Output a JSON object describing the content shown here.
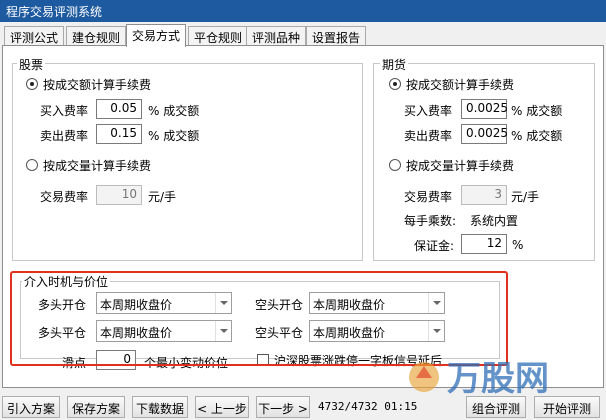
{
  "window": {
    "title": "程序交易评测系统"
  },
  "tabs": [
    "评测公式",
    "建仓规则",
    "交易方式",
    "平仓规则",
    "评测品种",
    "设置报告"
  ],
  "stocks": {
    "legend": "股票",
    "by_amount_label": "按成交额计算手续费",
    "buy_label": "买入费率",
    "buy_value": "0.05",
    "buy_unit": "% 成交额",
    "sell_label": "卖出费率",
    "sell_value": "0.15",
    "sell_unit": "% 成交额",
    "by_volume_label": "按成交量计算手续费",
    "rate_label": "交易费率",
    "rate_value": "10",
    "rate_unit": "元/手"
  },
  "futures": {
    "legend": "期货",
    "by_amount_label": "按成交额计算手续费",
    "buy_label": "买入费率",
    "buy_value": "0.0025",
    "buy_unit": "% 成交额",
    "sell_label": "卖出费率",
    "sell_value": "0.0025",
    "sell_unit": "% 成交额",
    "by_volume_label": "按成交量计算手续费",
    "rate_label": "交易费率",
    "rate_value": "3",
    "rate_unit": "元/手",
    "multiplier_label": "每手乘数:",
    "multiplier_value": "系统内置",
    "margin_label": "保证金:",
    "margin_value": "12",
    "margin_unit": "%"
  },
  "entry": {
    "legend": "介入时机与价位",
    "long_open_label": "多头开仓",
    "long_open_value": "本周期收盘价",
    "short_open_label": "空头开仓",
    "short_open_value": "本周期收盘价",
    "long_close_label": "多头平仓",
    "long_close_value": "本周期收盘价",
    "short_close_label": "空头平仓",
    "short_close_value": "本周期收盘价",
    "slippage_label": "滑点",
    "slippage_value": "0",
    "slippage_unit": "个最小变动价位",
    "limit_check_label": "沪深股票涨跌停一字板信号延后"
  },
  "footer": {
    "import_label": "引入方案",
    "save_label": "保存方案",
    "download_label": "下载数据",
    "prev_label": "< 上一步",
    "next_label": "下一步 >",
    "status": "4732/4732 01:15",
    "combo_label": "组合评测",
    "start_label": "开始评测"
  },
  "watermark": {
    "text": "万股网"
  },
  "colors": {
    "titlebar": "#1e5a9f",
    "highlight": "#e0301e",
    "watermark": "#2f6fb6"
  }
}
